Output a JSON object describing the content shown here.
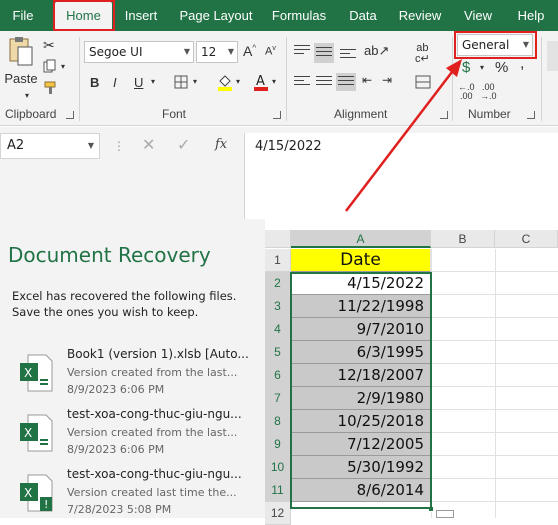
{
  "tabs": [
    {
      "label": "File",
      "active": false
    },
    {
      "label": "Home",
      "active": true
    },
    {
      "label": "Insert",
      "active": false
    },
    {
      "label": "Page Layout",
      "active": false
    },
    {
      "label": "Formulas",
      "active": false
    },
    {
      "label": "Data",
      "active": false
    },
    {
      "label": "Review",
      "active": false
    },
    {
      "label": "View",
      "active": false
    },
    {
      "label": "Help",
      "active": false
    }
  ],
  "ribbon": {
    "clipboard": {
      "paste_label": "Paste",
      "group_label": "Clipboard"
    },
    "font": {
      "family": "Segoe UI",
      "size": "12",
      "group_label": "Font",
      "bold": "B",
      "italic": "I",
      "underline": "U",
      "grow": "A",
      "shrink": "A"
    },
    "alignment": {
      "group_label": "Alignment"
    },
    "number": {
      "format": "General",
      "group_label": "Number",
      "currency": "$",
      "percent": "%",
      "comma": ","
    }
  },
  "formula_bar": {
    "name_box": "A2",
    "content": "4/15/2022",
    "fx": "fx"
  },
  "recovery": {
    "title": "Document Recovery",
    "description": "Excel has recovered the following files.  Save the ones you wish to keep.",
    "items": [
      {
        "name": "Book1 (version 1).xlsb  [Auto...",
        "version": "Version created from the last...",
        "date": "8/9/2023 6:06 PM"
      },
      {
        "name": "test-xoa-cong-thuc-giu-ngu...",
        "version": "Version created from the last...",
        "date": "8/9/2023 6:06 PM"
      },
      {
        "name": "test-xoa-cong-thuc-giu-ngu...",
        "version": "Version created last time the...",
        "date": "7/28/2023 5:08 PM"
      }
    ]
  },
  "sheet": {
    "columns": [
      "A",
      "B",
      "C"
    ],
    "rows": [
      "1",
      "2",
      "3",
      "4",
      "5",
      "6",
      "7",
      "8",
      "9",
      "10",
      "11",
      "12"
    ],
    "header": "Date",
    "values": [
      "4/15/2022",
      "11/22/1998",
      "9/7/2010",
      "6/3/1995",
      "12/18/2007",
      "2/9/1980",
      "10/25/2018",
      "7/12/2005",
      "5/30/1992",
      "8/6/2014"
    ]
  },
  "colors": {
    "accent": "#217346",
    "highlight_box": "#e0201e",
    "header_fill": "#ffff00",
    "selected_fill": "#c9c9c9"
  }
}
